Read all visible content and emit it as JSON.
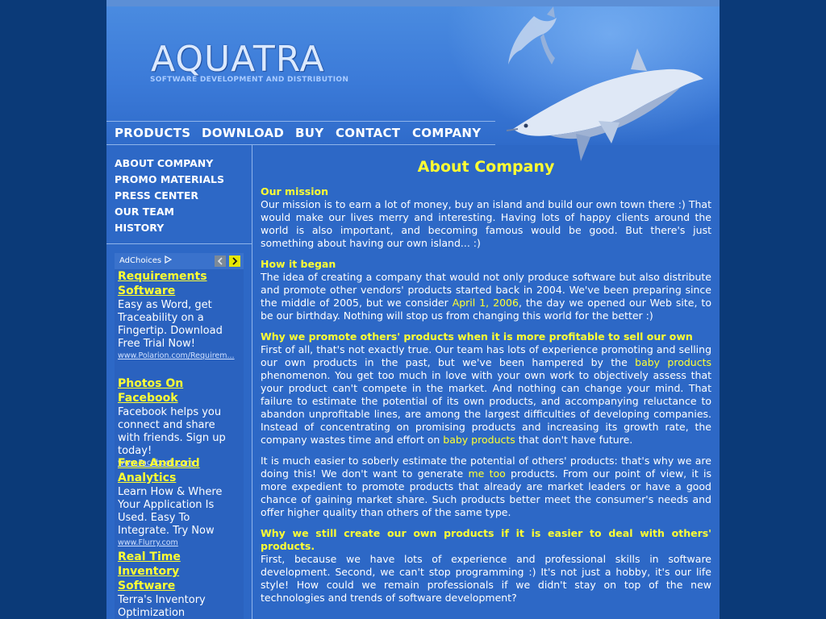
{
  "header": {
    "logo": "AQUATRA",
    "tagline": "SOFTWARE DEVELOPMENT AND DISTRIBUTION"
  },
  "topnav": [
    "PRODUCTS",
    "DOWNLOAD",
    "BUY",
    "CONTACT",
    "COMPANY"
  ],
  "sidenav": [
    "ABOUT COMPANY",
    "PROMO MATERIALS",
    "PRESS CENTER",
    "OUR TEAM",
    "HISTORY"
  ],
  "ads": {
    "adchoices_label": "AdChoices",
    "items": [
      {
        "title": "Requirements Software",
        "desc": "Easy as Word, get Traceability on a Fingertip. Download Free Trial Now!",
        "url": "www.Polarion.com/Requirem..."
      },
      {
        "title": "Photos On Facebook",
        "desc": "Facebook helps you connect and share with friends. Sign up today!",
        "url": "www.Facebook.com"
      },
      {
        "title": "Free Android Analytics",
        "desc": "Learn How & Where Your Application Is Used. Easy To Integrate. Try Now",
        "url": "www.Flurry.com"
      },
      {
        "title": "Real Time Inventory Software",
        "desc": "Terra's Inventory Optimization decreases inventory more than",
        "url": ""
      }
    ]
  },
  "content": {
    "title": "About Company",
    "s1": {
      "heading": "Our mission",
      "text": "Our mission is to earn a lot of money, buy an island and build our own town there :) That would make our lives merry and interesting. Having lots of happy clients around the world is also important, and becoming famous would be good. But there's just something about having our own island... :)"
    },
    "s2": {
      "heading": "How it began",
      "text_a": "The idea of creating a company that would not only produce software but also distribute and promote other vendors' products started back in 2004. We've been preparing since the middle of 2005, but we consider ",
      "link": "April 1, 2006",
      "text_b": ", the day we opened our Web site, to be our birthday. Nothing will stop us from changing this world for the better :)"
    },
    "s3": {
      "heading": "Why we promote others' products when it is more profitable to sell our own",
      "p1_a": "First of all, that's not exactly true. Our team has lots of experience promoting and selling our own products in the past, but we've been hampered by the ",
      "p1_link1": "baby products",
      "p1_b": " phenomenon. You get too much in love with your own work to objectively assess that your product can't compete in the market. And nothing can change your mind. That failure to estimate the potential of its own products, and accompanying reluctance to abandon unprofitable lines, are among the largest difficulties of developing companies. Instead of concentrating on promising products and increasing its growth rate, the company wastes time and effort on ",
      "p1_link2": "baby products",
      "p1_c": " that don't have future.",
      "p2_a": "It is much easier to soberly estimate the potential of others' products: that's why we are doing this! We don't want to generate ",
      "p2_link": "me too",
      "p2_b": " products. From our point of view, it is more expedient to promote products that already are market leaders or have a good chance of gaining market share. Such products better meet the consumer's needs and offer higher quality than others of the same type."
    },
    "s4": {
      "heading": "Why we still create our own products if it is easier to deal with others' products.",
      "text": "First, because we have lots of experience and professional skills in software development. Second, we can't stop programming :) It's not just a hobby, it's our life style! How could we remain professionals if we didn't stay on top of the new technologies and trends of software development?"
    }
  },
  "colors": {
    "page_bg": "#0b3a78",
    "content_bg": "#2d68c6",
    "accent_yellow": "#ffff33",
    "text": "#ffffff",
    "divider": "#8fb4ea"
  }
}
